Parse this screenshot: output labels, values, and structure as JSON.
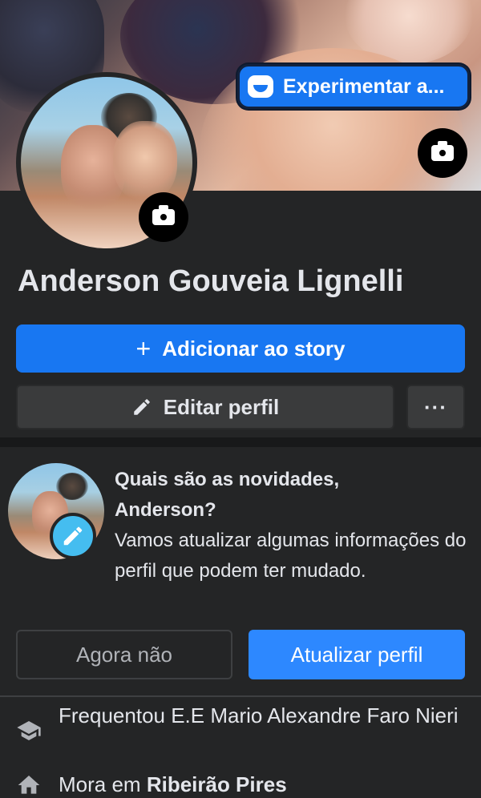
{
  "cover": {
    "experimentar_label": "Experimentar a..."
  },
  "profile": {
    "name": "Anderson Gouveia Lignelli"
  },
  "actions": {
    "story_label": "Adicionar ao story",
    "story_icon": "plus-icon",
    "edit_label": "Editar perfil",
    "edit_icon": "pencil-icon",
    "more_label": "···"
  },
  "prompt": {
    "heading_line1": "Quais são as novidades,",
    "heading_line2": "Anderson?",
    "body": "Vamos atualizar algumas informações do perfil que podem ter mudado.",
    "dismiss_label": "Agora não",
    "update_label": "Atualizar perfil"
  },
  "details": [
    {
      "icon": "graduation-cap-icon",
      "text": "Frequentou E.E Mario Alexandre Faro Nieri"
    },
    {
      "icon": "home-icon",
      "prefix": "Mora em ",
      "place": "Ribeirão Pires"
    }
  ],
  "colors": {
    "background": "#242526",
    "divider": "#18191a",
    "primary_blue": "#1877f2",
    "secondary_button": "#3a3b3c",
    "text": "#e4e6eb",
    "edit_badge": "#45bdf0"
  }
}
